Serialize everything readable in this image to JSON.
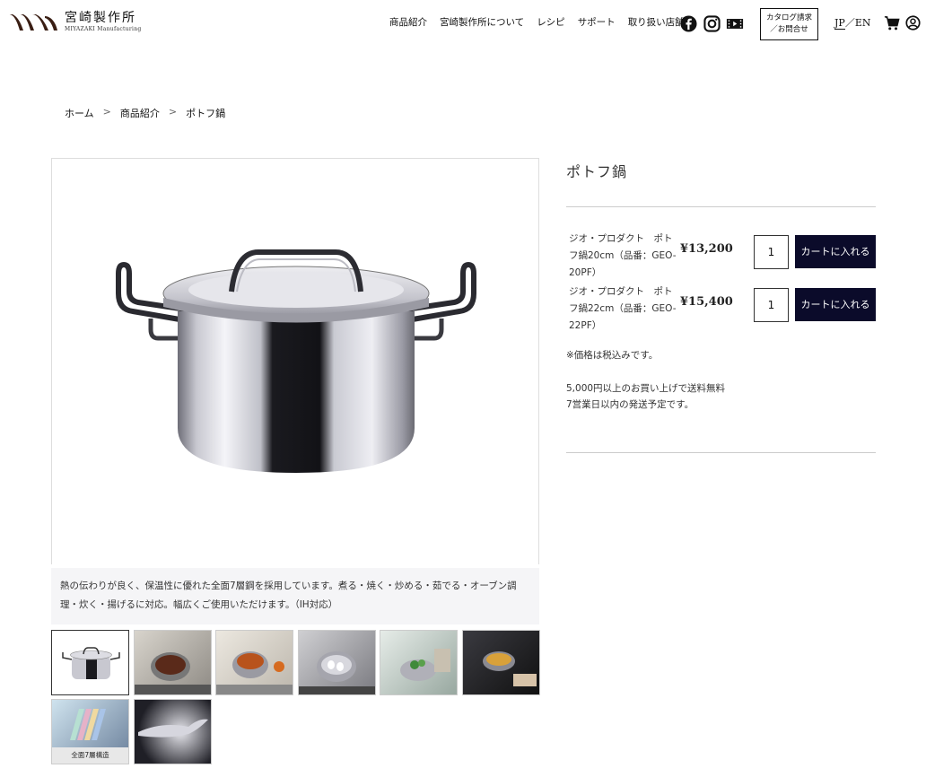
{
  "header": {
    "logo_jp": "宮崎製作所",
    "logo_en": "MIYAZAKI Manufacturing",
    "nav": [
      "商品紹介",
      "宮崎製作所について",
      "レシピ",
      "サポート",
      "取り扱い店舗"
    ],
    "catalog_line1": "カタログ請求",
    "catalog_line2": "／お問合せ",
    "lang_jp": "JP",
    "lang_sep": "／",
    "lang_en": "EN"
  },
  "breadcrumb": {
    "home": "ホーム",
    "sep1": ">",
    "category": "商品紹介",
    "sep2": ">",
    "current": "ポトフ鍋"
  },
  "product": {
    "title": "ポトフ鍋",
    "description": "熱の伝わりが良く、保温性に優れた全面7層鋼を採用しています。煮る・焼く・炒める・茹でる・オーブン調理・炊く・揚げるに対応。幅広くご使用いただけます。（IH対応）",
    "variants": [
      {
        "name": "ジオ・プロダクト　ポトフ鍋20cm（品番：GEO-20PF）",
        "price": "¥13,200",
        "qty": "1",
        "cart_label": "カートに入れる"
      },
      {
        "name": "ジオ・プロダクト　ポトフ鍋22cm（品番：GEO-22PF）",
        "price": "¥15,400",
        "qty": "1",
        "cart_label": "カートに入れる"
      }
    ],
    "tax_note": "※価格は税込みです。",
    "shipping_note1": "5,000円以上のお買い上げで送料無料",
    "shipping_note2": "7営業日以内の発送予定です。"
  },
  "thumbnails": {
    "caption_layer": "全面7層構造"
  },
  "colors": {
    "accent": "#0b0b2a",
    "desc_bg": "#f5f5f7",
    "divider": "#cccccc"
  },
  "icons": [
    "facebook-icon",
    "instagram-icon",
    "video-icon",
    "cart-icon",
    "user-icon"
  ]
}
